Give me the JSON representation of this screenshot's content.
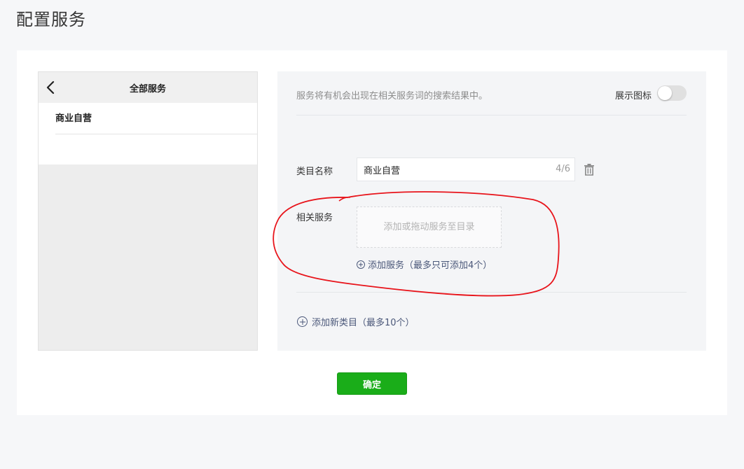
{
  "page": {
    "title": "配置服务"
  },
  "preview": {
    "header_title": "全部服务",
    "back_icon": "chevron-left-icon",
    "items": [
      {
        "label": "商业自营"
      }
    ]
  },
  "config": {
    "hint": "服务将有机会出现在相关服务词的搜索结果中。",
    "show_icon_label": "展示图标",
    "show_icon_enabled": false,
    "category": {
      "label": "类目名称",
      "value": "商业自营",
      "counter": "4/6",
      "delete_icon": "trash-icon"
    },
    "related": {
      "label": "相关服务",
      "drop_placeholder": "添加或拖动服务至目录",
      "add_link": "添加服务（最多只可添加4个）"
    },
    "add_category_link": "添加新类目（最多10个）"
  },
  "footer": {
    "confirm_label": "确定"
  },
  "colors": {
    "accent_green": "#1aad19",
    "link": "#4a5779",
    "annotation_red": "#e8141b"
  }
}
